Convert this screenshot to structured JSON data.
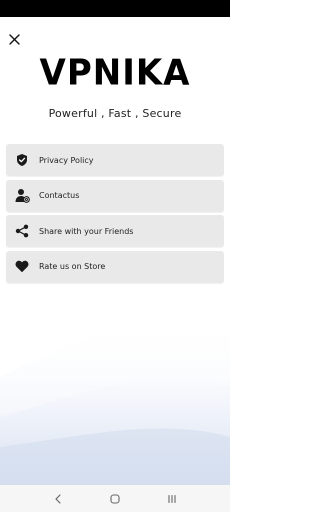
{
  "app": {
    "title": "VPNIKA",
    "tagline": "Powerful , Fast , Secure"
  },
  "icons": {
    "close": "close-icon",
    "privacy": "shield-check-icon",
    "contact": "person-at-icon",
    "share": "share-icon",
    "rate": "heart-icon"
  },
  "menu": {
    "items": [
      {
        "label": "Privacy Policy",
        "icon": "shield-check-icon"
      },
      {
        "label": "Contactus",
        "icon": "person-at-icon"
      },
      {
        "label": "Share with your Friends",
        "icon": "share-icon"
      },
      {
        "label": "Rate us on Store",
        "icon": "heart-icon"
      }
    ]
  },
  "navigation": {
    "back": "back-icon",
    "home": "home-icon",
    "recents": "recents-icon"
  },
  "colors": {
    "status_bar": "#000000",
    "menu_item_bg": "#e9e9e9",
    "wave_blue": "#dfe6f4"
  }
}
